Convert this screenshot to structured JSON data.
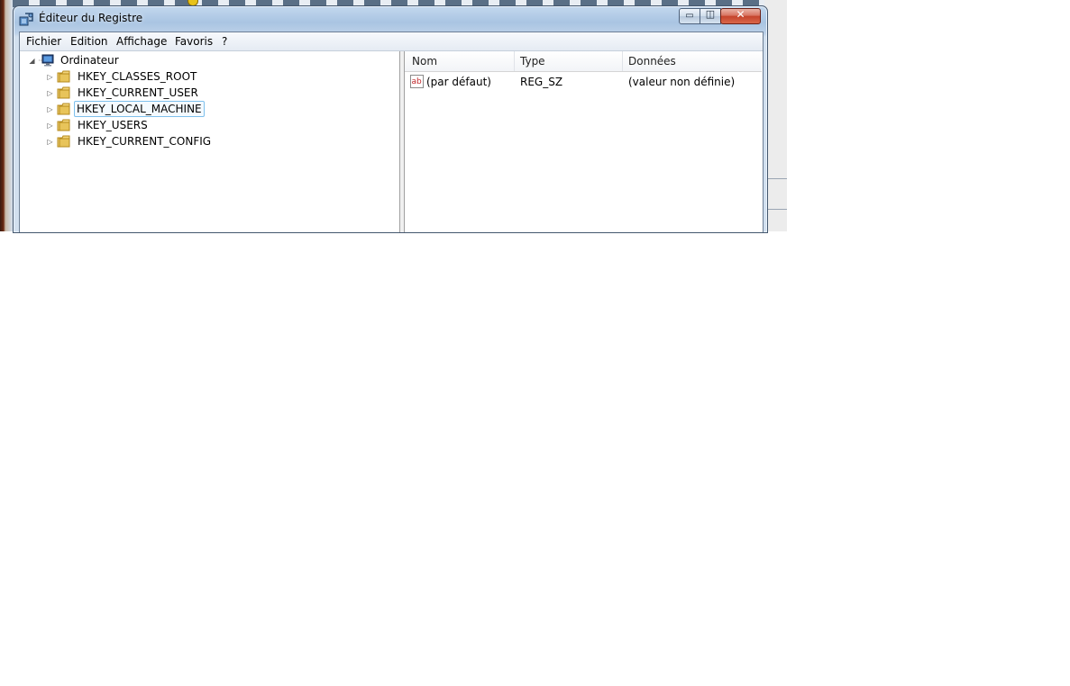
{
  "window": {
    "title": "Éditeur du Registre",
    "app_icon": "registry-editor-icon",
    "controls": {
      "minimize": "▭",
      "maximize": "◫",
      "close": "✕"
    }
  },
  "menu": {
    "items": [
      "Fichier",
      "Edition",
      "Affichage",
      "Favoris",
      "?"
    ]
  },
  "tree": {
    "root": "Ordinateur",
    "keys": [
      "HKEY_CLASSES_ROOT",
      "HKEY_CURRENT_USER",
      "HKEY_LOCAL_MACHINE",
      "HKEY_USERS",
      "HKEY_CURRENT_CONFIG"
    ],
    "selected": "HKEY_LOCAL_MACHINE"
  },
  "list": {
    "columns": [
      "Nom",
      "Type",
      "Données"
    ],
    "rows": [
      {
        "name": "(par défaut)",
        "type": "REG_SZ",
        "data": "(valeur non définie)",
        "icon": "string-value-icon",
        "icon_text": "ab"
      }
    ]
  },
  "colors": {
    "title_bar": "#a9c4e2",
    "selection_border": "#7ec0ec",
    "close_button": "#c5442c",
    "folder": "#e8c45a"
  }
}
